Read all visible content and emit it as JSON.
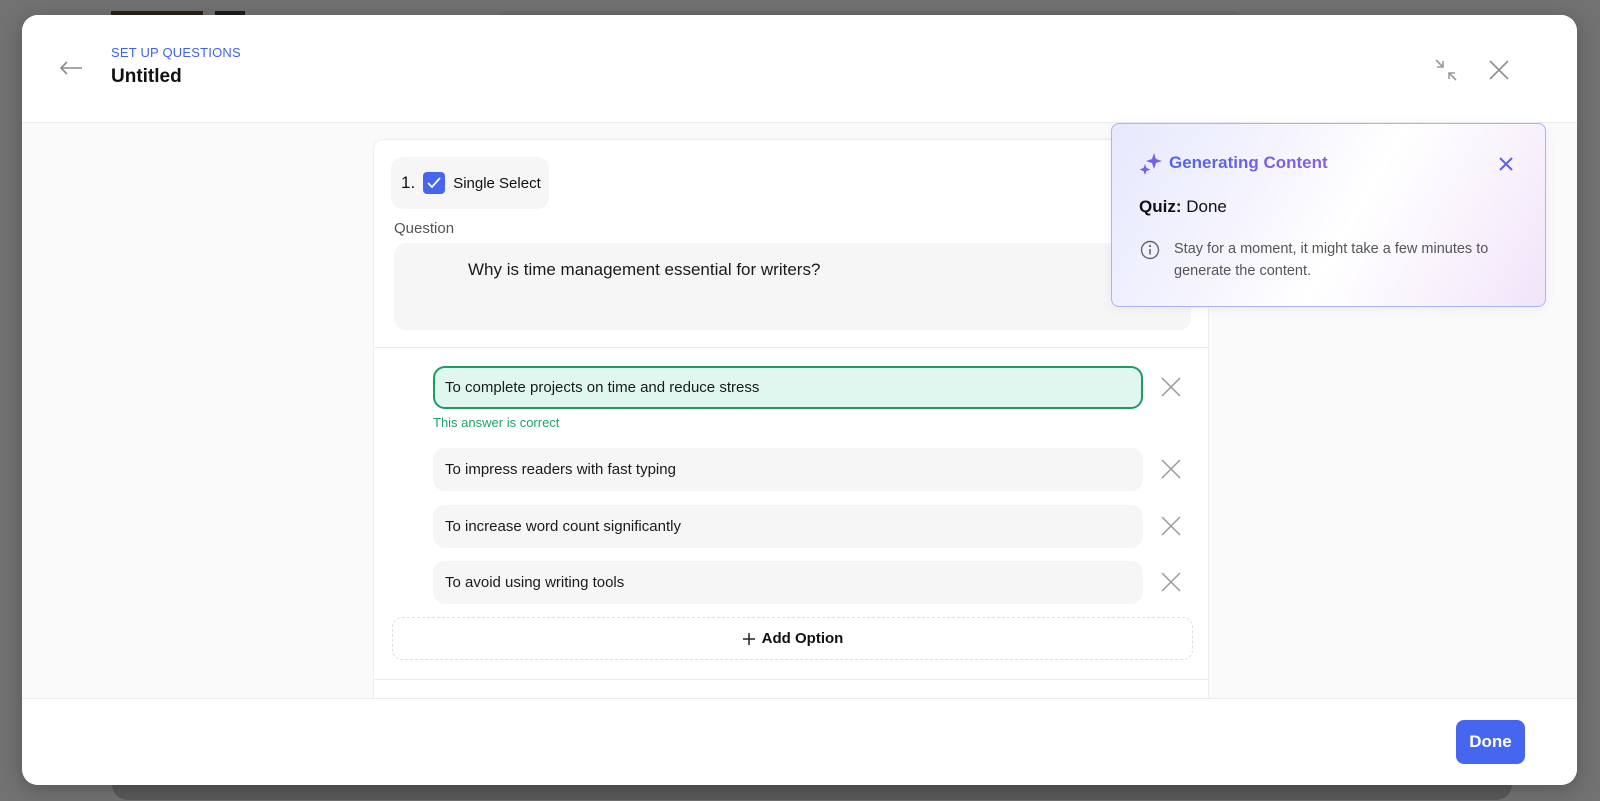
{
  "header": {
    "eyebrow": "SET UP QUESTIONS",
    "title": "Untitled",
    "back_icon": "arrow-left-icon",
    "minimize_icon": "collapse-icon",
    "close_icon": "close-icon"
  },
  "question": {
    "number": "1.",
    "type_label": "Single Select",
    "label": "Question",
    "text": "Why is time management essential for writers?",
    "options": [
      {
        "text": "To complete projects on time and reduce stress",
        "correct": true
      },
      {
        "text": "To impress readers with fast typing",
        "correct": false
      },
      {
        "text": "To increase word count significantly",
        "correct": false
      },
      {
        "text": "To avoid using writing tools",
        "correct": false
      }
    ],
    "correct_note": "This answer is correct",
    "add_option_label": "Add Option"
  },
  "footer": {
    "done_label": "Done",
    "accent_color": "#4766f0"
  },
  "toast": {
    "title": "Generating Content",
    "status_label": "Quiz:",
    "status_value": "Done",
    "message": "Stay for a moment, it might take a few minutes to generate the content.",
    "icon": "sparkles-icon",
    "info_icon": "info-icon"
  }
}
